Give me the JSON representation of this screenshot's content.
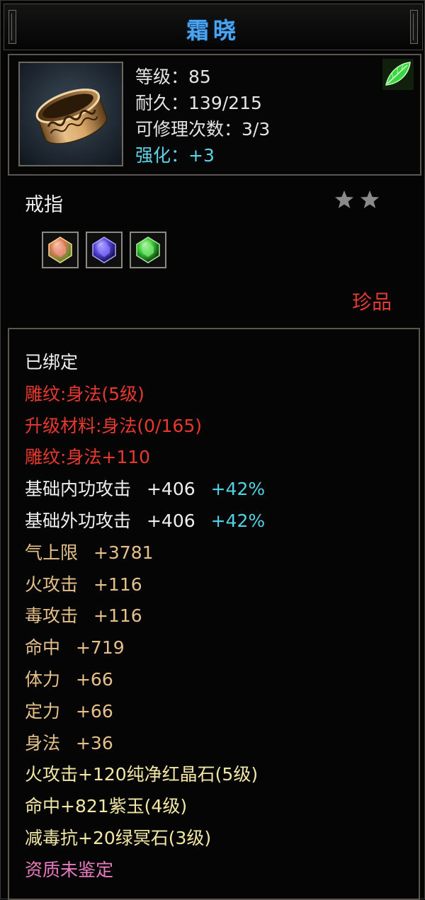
{
  "title": "霜晓",
  "item": {
    "icon": "ring-icon",
    "stats": [
      {
        "label": "等级",
        "value": "85"
      },
      {
        "label": "耐久",
        "value": "139/215"
      },
      {
        "label": "可修理次数",
        "value": "3/3"
      }
    ],
    "enhance": {
      "label": "强化",
      "value": "+3"
    },
    "top_right_icon": "green-leaf-icon",
    "type": "戒指",
    "stars": 2,
    "gems": [
      {
        "icon": "red-gem-icon",
        "color": "#e07a5a"
      },
      {
        "icon": "purple-gem-icon",
        "color": "#5a4adf"
      },
      {
        "icon": "green-gem-icon",
        "color": "#3fcf3a"
      }
    ],
    "rarity": "珍品"
  },
  "attributes": {
    "bound": "已绑定",
    "engraving": "雕纹:身法(5级)",
    "upgrade_material": "升级材料:身法(0/165)",
    "engraving_bonus": "雕纹:身法+110",
    "inner_attack": {
      "label": "基础内功攻击",
      "value": "+406",
      "pct": "+42%"
    },
    "outer_attack": {
      "label": "基础外功攻击",
      "value": "+406",
      "pct": "+42%"
    },
    "basic": [
      {
        "label": "气上限",
        "value": "+3781"
      },
      {
        "label": "火攻击",
        "value": "+116"
      },
      {
        "label": "毒攻击",
        "value": "+116"
      },
      {
        "label": "命中",
        "value": "+719"
      },
      {
        "label": "体力",
        "value": "+66"
      },
      {
        "label": "定力",
        "value": "+66"
      },
      {
        "label": "身法",
        "value": "+36"
      }
    ],
    "gem_lines": [
      "火攻击+120纯净红晶石(5级)",
      "命中+821紫玉(4级)",
      "减毒抗+20绿冥石(3级)"
    ],
    "quality": "资质未鉴定"
  },
  "colors": {
    "title": "#4aa4f2",
    "enhance": "#5fd2e6",
    "red_text": "#e8392e",
    "gold_text": "#e5c089",
    "yellow_text": "#f3e7a4",
    "pink_text": "#e97cc0",
    "percent": "#52d2e6"
  }
}
